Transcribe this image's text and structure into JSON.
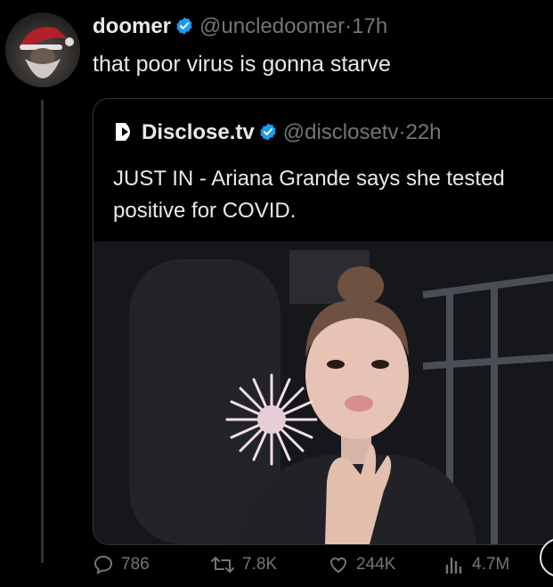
{
  "tweet": {
    "author_name": "doomer",
    "handle": "@uncledoomer",
    "separator": "·",
    "time": "17h",
    "text": "that poor virus is gonna starve"
  },
  "quote": {
    "author_name": "Disclose.tv",
    "handle": "@disclosetv",
    "separator": "·",
    "time": "22h",
    "text": "JUST IN - Ariana Grande says she tested positive for COVID."
  },
  "actions": {
    "replies": "786",
    "retweets": "7.8K",
    "likes": "244K",
    "views": "4.7M"
  },
  "colors": {
    "background": "#000000",
    "text": "#e7e9ea",
    "muted": "#71767b",
    "verified": "#1d9bf0",
    "border": "#2f3336"
  },
  "icons": [
    "verified-badge-icon",
    "disclose-tv-logo-icon",
    "reply-icon",
    "retweet-icon",
    "like-icon",
    "views-icon"
  ]
}
